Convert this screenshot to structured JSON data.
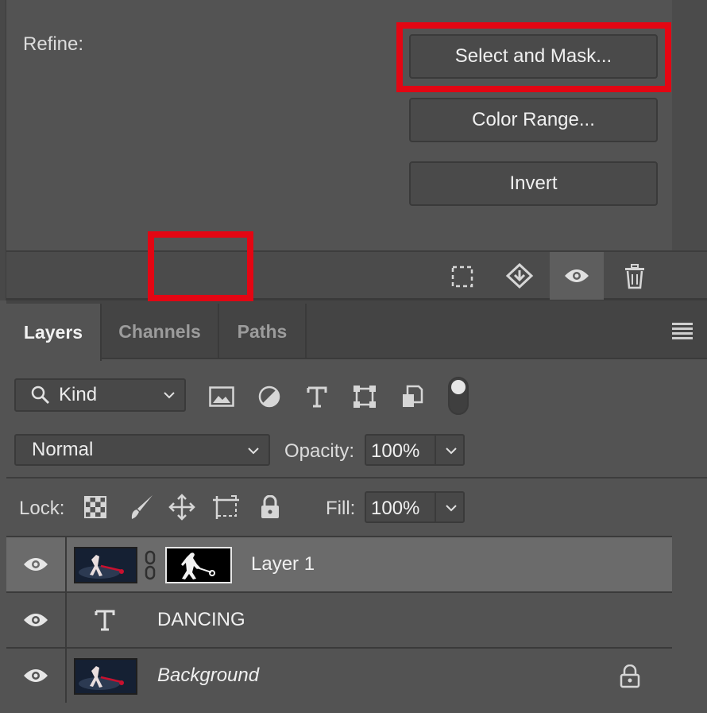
{
  "properties": {
    "refine_label": "Refine:",
    "buttons": {
      "select_and_mask": "Select and Mask...",
      "color_range": "Color Range...",
      "invert": "Invert"
    },
    "footer_icons": [
      "selection-from-mask-icon",
      "apply-mask-icon",
      "visibility-eye-icon",
      "trash-icon"
    ]
  },
  "layers_panel": {
    "tabs": [
      {
        "label": "Layers",
        "active": true
      },
      {
        "label": "Channels",
        "active": false
      },
      {
        "label": "Paths",
        "active": false
      }
    ],
    "filter": {
      "kind_label": "Kind",
      "filter_icons": [
        "image-filter-icon",
        "adjustment-filter-icon",
        "type-filter-icon",
        "shape-filter-icon",
        "smart-object-filter-icon"
      ]
    },
    "blend_mode": "Normal",
    "opacity_label": "Opacity:",
    "opacity_value": "100%",
    "lock_label": "Lock:",
    "fill_label": "Fill:",
    "fill_value": "100%",
    "layers": [
      {
        "name": "Layer 1",
        "selected": true,
        "type": "pixel-with-mask"
      },
      {
        "name": "DANCING",
        "selected": false,
        "type": "text"
      },
      {
        "name": "Background",
        "selected": false,
        "type": "background",
        "locked": true
      }
    ]
  },
  "colors": {
    "panel_bg": "#535353",
    "highlight_red": "#e30613",
    "selected_row": "#6b6b6b"
  }
}
